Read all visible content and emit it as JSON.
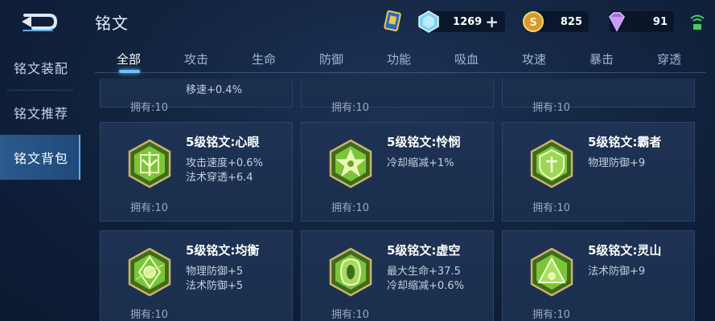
{
  "header": {
    "title": "铭文",
    "currencies": {
      "diamond": "1269",
      "gold": "825",
      "gem": "91"
    }
  },
  "sidebar": {
    "items": [
      {
        "label": "铭文装配"
      },
      {
        "label": "铭文推荐"
      },
      {
        "label": "铭文背包"
      }
    ],
    "active": "铭文背包"
  },
  "tabs": {
    "items": [
      "全部",
      "攻击",
      "生命",
      "防御",
      "功能",
      "吸血",
      "攻速",
      "暴击",
      "穿透"
    ],
    "active": "全部"
  },
  "cards": {
    "partial_top": [
      {
        "stat": "移速+0.4%",
        "owned": "拥有:10"
      },
      {
        "owned": "拥有:10"
      },
      {
        "owned": "拥有:10"
      }
    ],
    "row1": [
      {
        "name": "5级铭文:心眼",
        "stats": [
          "攻击速度+0.6%",
          "法术穿透+6.4"
        ],
        "owned": "拥有:10",
        "icon": "xinyan-inscription-icon"
      },
      {
        "name": "5级铭文:怜悯",
        "stats": [
          "冷却缩减+1%"
        ],
        "owned": "拥有:10",
        "icon": "lianmin-inscription-icon"
      },
      {
        "name": "5级铭文:霸者",
        "stats": [
          "物理防御+9"
        ],
        "owned": "拥有:10",
        "icon": "bazhe-inscription-icon"
      }
    ],
    "row2": [
      {
        "name": "5级铭文:均衡",
        "stats": [
          "物理防御+5",
          "法术防御+5"
        ],
        "owned": "拥有:10",
        "icon": "junheng-inscription-icon"
      },
      {
        "name": "5级铭文:虚空",
        "stats": [
          "最大生命+37.5",
          "冷却缩减+0.6%"
        ],
        "owned": "拥有:10",
        "icon": "xukong-inscription-icon"
      },
      {
        "name": "5级铭文:灵山",
        "stats": [
          "法术防御+9"
        ],
        "owned": "拥有:10",
        "icon": "lingshan-inscription-icon"
      }
    ]
  },
  "colors": {
    "inscription_green": "#7ec43a",
    "inscription_gold": "#c9b36a",
    "accent_blue": "#6ec2ff"
  }
}
